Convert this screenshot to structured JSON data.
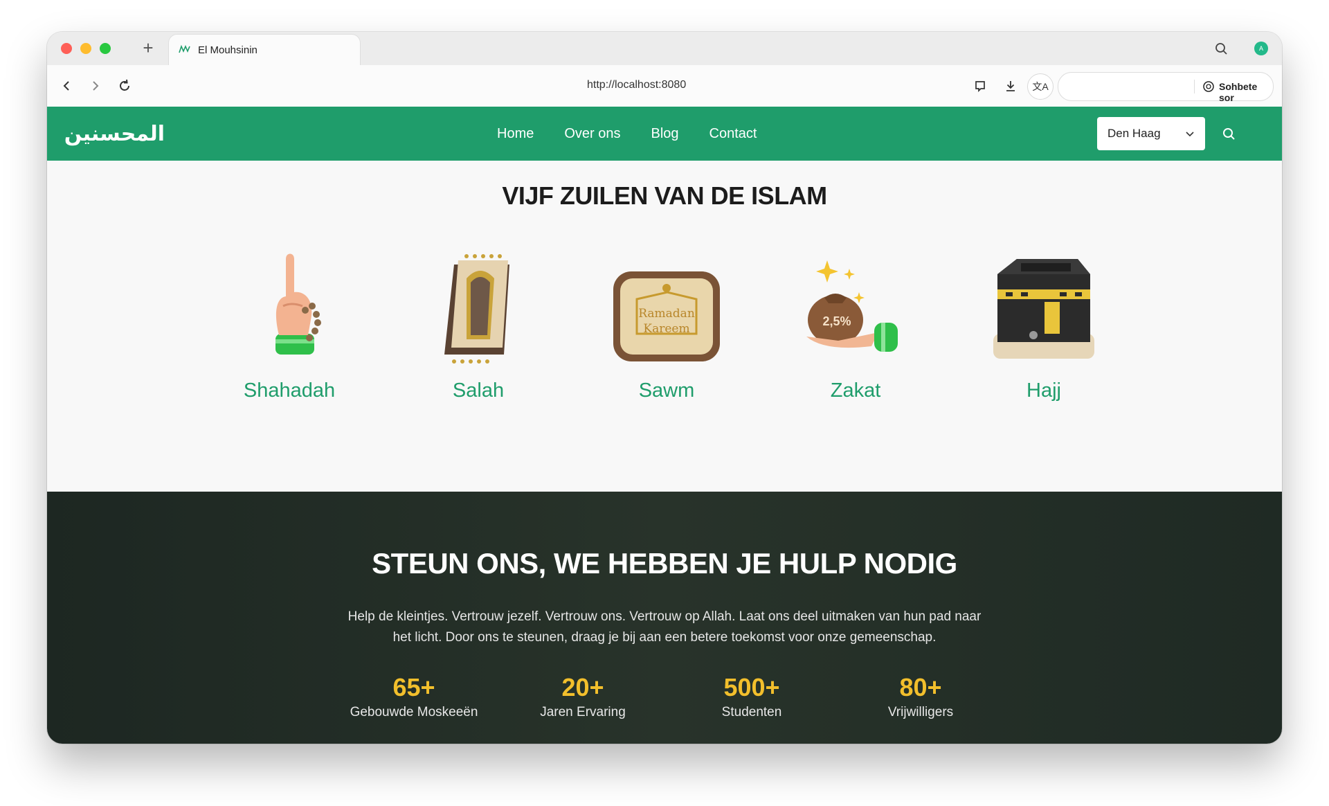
{
  "browser": {
    "tab_title": "El Mouhsinin",
    "url": "http://localhost:8080",
    "ai_button_label": "Sohbete sor",
    "translate_icon": "translate-icon",
    "profile_initial": "A"
  },
  "header": {
    "logo_text": "المحسنين",
    "nav": [
      "Home",
      "Over ons",
      "Blog",
      "Contact"
    ],
    "city_selected": "Den Haag",
    "accent": "#1f9d6b"
  },
  "pillars": {
    "title": "VIJF ZUILEN VAN DE ISLAM",
    "items": [
      {
        "label": "Shahadah",
        "icon": "raised-finger-tasbih-icon"
      },
      {
        "label": "Salah",
        "icon": "prayer-mat-icon"
      },
      {
        "label": "Sawm",
        "icon": "ramadan-kareem-plaque-icon",
        "sign_text_1": "Ramadan",
        "sign_text_2": "Kareem"
      },
      {
        "label": "Zakat",
        "icon": "money-bag-icon",
        "bag_text": "2,5%"
      },
      {
        "label": "Hajj",
        "icon": "kaaba-icon"
      }
    ]
  },
  "donate": {
    "title": "STEUN ONS, WE HEBBEN JE HULP NODIG",
    "text": "Help de kleintjes. Vertrouw jezelf. Vertrouw ons. Vertrouw op Allah. Laat ons deel uitmaken van hun pad naar het licht. Door ons te steunen, draag je bij aan een betere toekomst voor onze gemeenschap.",
    "stats": [
      {
        "value": "65+",
        "label": "Gebouwde Moskeeën"
      },
      {
        "value": "20+",
        "label": "Jaren Ervaring"
      },
      {
        "value": "500+",
        "label": "Studenten"
      },
      {
        "value": "80+",
        "label": "Vrijwilligers"
      }
    ],
    "stat_color": "#f2bf2c"
  }
}
